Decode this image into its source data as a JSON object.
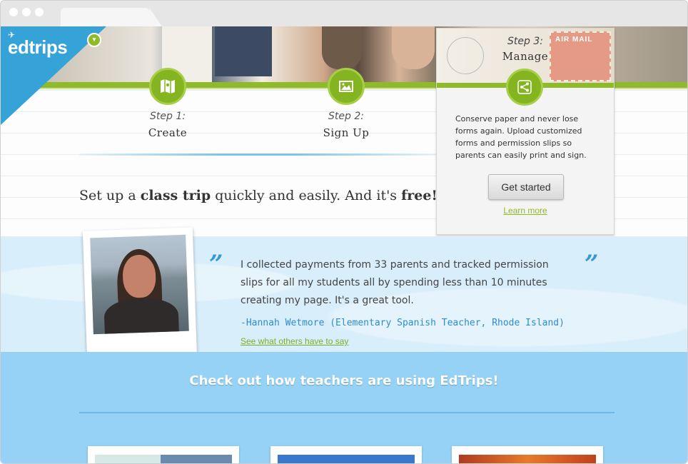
{
  "browser": {
    "tab_label": ""
  },
  "logo": {
    "text": "edtrips"
  },
  "steps": [
    {
      "num": "Step 1:",
      "title": "Create",
      "icon": "map-icon"
    },
    {
      "num": "Step 2:",
      "title": "Sign Up",
      "icon": "image-icon"
    },
    {
      "num": "Step 3:",
      "title": "Manage",
      "icon": "share-icon"
    }
  ],
  "tagline": {
    "pre": "Set up a ",
    "bold1": "class trip",
    "mid": " quickly and easily. And it's ",
    "bold2": "free!"
  },
  "card": {
    "stamp_text": "AIR MAIL",
    "step_num": "Step 3:",
    "step_title": "Manage",
    "description": "Conserve paper and never lose forms again. Upload customized forms and permission slips so parents can easily print and sign.",
    "button": "Get started",
    "link": "Learn more"
  },
  "testimonial": {
    "open_quote": "”",
    "close_quote": "”",
    "text": "I collected payments from 33 parents and tracked permission slips for all my students all by spending less than 10 minutes creating my page. It's a great tool.",
    "author": "-Hannah Wetmore (Elementary Spanish Teacher, Rhode Island)",
    "link": "See what others have to say"
  },
  "bottom": {
    "title": "Check out how teachers are using EdTrips!"
  },
  "colors": {
    "brand_blue": "#35a2d8",
    "brand_green": "#8fbb2a",
    "testimonial_bg": "#d9eefb",
    "bottom_bg": "#95d2f5"
  }
}
